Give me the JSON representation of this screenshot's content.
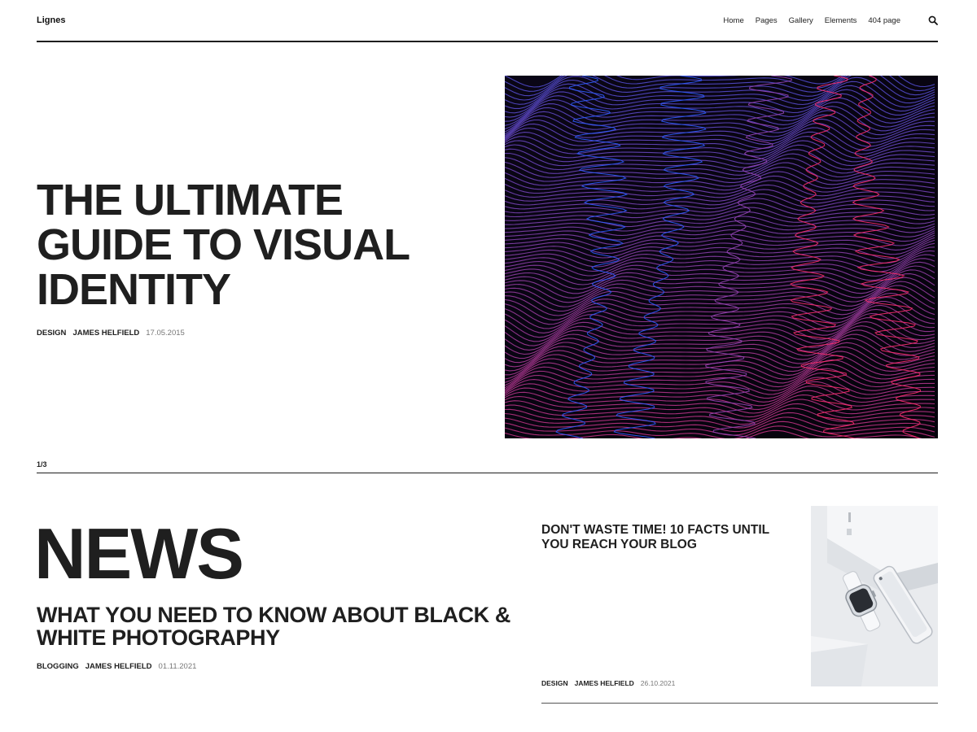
{
  "site": {
    "logo": "Lignes"
  },
  "nav": {
    "items": [
      "Home",
      "Pages",
      "Gallery",
      "Elements",
      "404 page"
    ],
    "search_icon": "search-icon"
  },
  "hero": {
    "title": "THE ULTIMATE GUIDE TO VISUAL IDENTITY",
    "category": "DESIGN",
    "author": "JAMES HELFIELD",
    "date": "17.05.2015",
    "image": "abstract light trails in blue and pink on black",
    "counter": "1/3"
  },
  "news": {
    "heading": "NEWS",
    "featured": {
      "title": "WHAT YOU NEED TO KNOW ABOUT BLACK & WHITE PHOTOGRAPHY",
      "category": "BLOGGING",
      "author": "JAMES HELFIELD",
      "date": "01.11.2021"
    },
    "side": {
      "title": "DON'T WASTE TIME! 10 FACTS UNTIL YOU REACH YOUR BLOG",
      "category": "DESIGN",
      "author": "JAMES HELFIELD",
      "date": "26.10.2021",
      "image": "smartwatch and phone on a white desk"
    }
  },
  "colors": {
    "text": "#1e1e1e",
    "muted": "#777777",
    "accent_blue": "#2e5cff",
    "accent_pink": "#ff2d6e"
  }
}
